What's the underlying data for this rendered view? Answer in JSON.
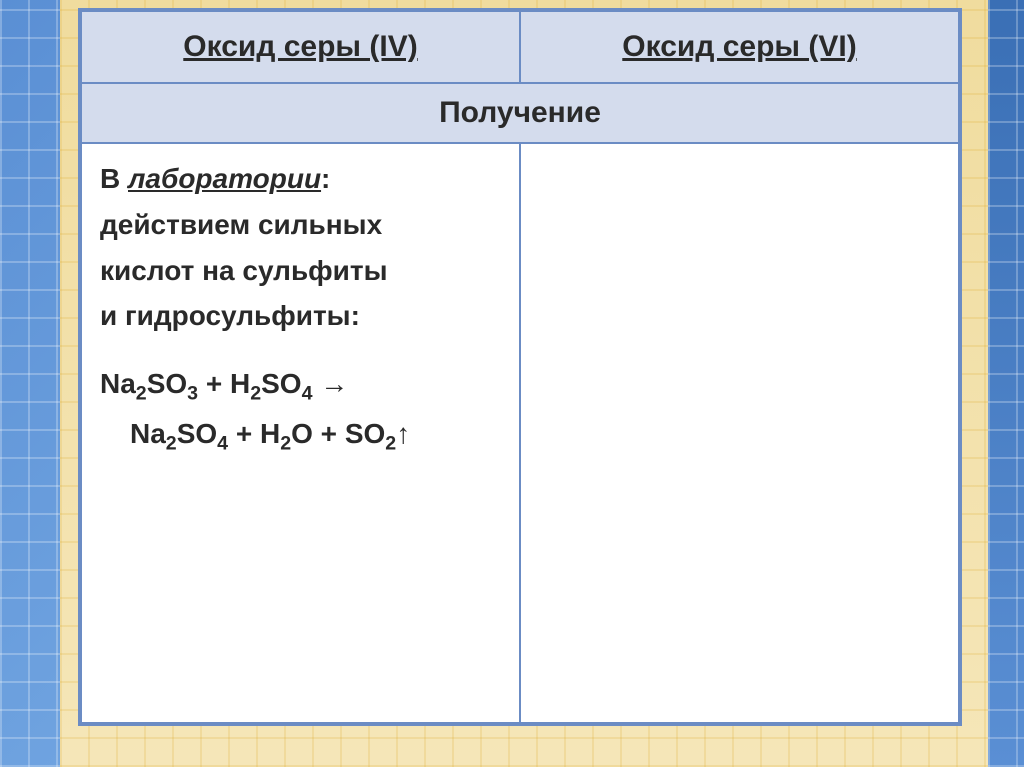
{
  "headers": {
    "col1": "Оксид серы (IV)",
    "col2": "Оксид серы (VI)"
  },
  "subheader": "Получение",
  "content": {
    "lab_prefix": "В ",
    "lab_label": "лаборатории",
    "lab_colon": ":",
    "description_line1": "действием сильных",
    "description_line2": "кислот на сульфиты",
    "description_line3": "и гидросульфиты:",
    "formula_reactant1": "Na",
    "formula_sub1": "2",
    "formula_reactant2": "SO",
    "formula_sub2": "3",
    "formula_plus1": " + H",
    "formula_sub3": "2",
    "formula_reactant3": "SO",
    "formula_sub4": "4",
    "formula_arrow": " →",
    "formula_product1": "Na",
    "formula_sub5": "2",
    "formula_product2": "SO",
    "formula_sub6": "4",
    "formula_plus2": " + H",
    "formula_sub7": "2",
    "formula_product3": "O + SO",
    "formula_sub8": "2",
    "formula_up": "↑"
  }
}
